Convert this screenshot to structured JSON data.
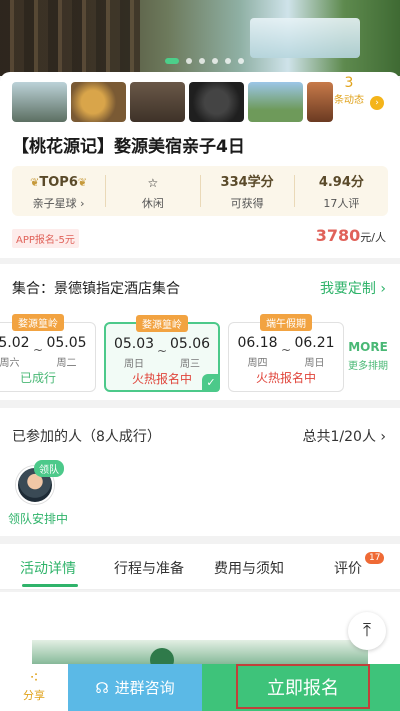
{
  "gallery": {
    "dynamic_count": "3",
    "dynamic_label": "条动态"
  },
  "product": {
    "title": "【桃花源记】婺源美宿亲子4日",
    "stats": [
      {
        "top": "TOP6",
        "bottom": "亲子星球 ›"
      },
      {
        "top": "",
        "bottom": "休闲"
      },
      {
        "top": "334学分",
        "bottom": "可获得"
      },
      {
        "top": "4.94分",
        "bottom": "17人评"
      }
    ],
    "app_tag": "APP报名-5元",
    "price": "3780",
    "price_unit": "元/人"
  },
  "gather": {
    "label": "集合：景德镇指定酒店集合",
    "custom_link": "我要定制 ›",
    "dates": [
      {
        "tag": "婺源篁岭",
        "start": "05.02",
        "end": "05.05",
        "start_day": "周六",
        "end_day": "周二",
        "status": "已成行",
        "state": "done"
      },
      {
        "tag": "婺源篁岭",
        "start": "05.03",
        "end": "05.06",
        "start_day": "周日",
        "end_day": "周三",
        "status": "火热报名中",
        "state": "selected"
      },
      {
        "tag": "端午假期",
        "start": "06.18",
        "end": "06.21",
        "start_day": "周四",
        "end_day": "周日",
        "status": "火热报名中",
        "state": "hot"
      }
    ],
    "tilde": "~",
    "more": "MORE",
    "more_sub": "更多排期"
  },
  "joined": {
    "title": "已参加的人（8人成行）",
    "total": "总共1/20人 ›",
    "leader_badge": "领队",
    "leader_text": "领队安排中"
  },
  "tabs": [
    {
      "label": "活动详情",
      "active": true
    },
    {
      "label": "行程与准备",
      "active": false
    },
    {
      "label": "费用与须知",
      "active": false
    },
    {
      "label": "评价",
      "active": false
    }
  ],
  "review_count": "17",
  "bottom": {
    "share": "分享",
    "consult": "进群咨询",
    "signup": "立即报名"
  },
  "colors": {
    "green": "#3ec37a",
    "blue": "#5bb9e6",
    "price": "#e0625a",
    "orange": "#f2a341"
  }
}
